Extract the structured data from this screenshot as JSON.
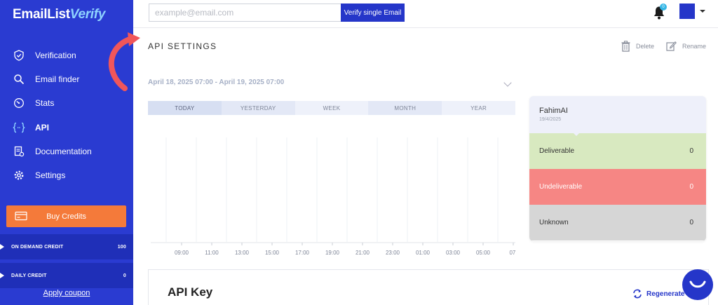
{
  "app": {
    "logo_main": "EmailList",
    "logo_accent": "Verify"
  },
  "sidebar": {
    "items": [
      {
        "label": "Verification",
        "icon": "shield-check-icon"
      },
      {
        "label": "Email finder",
        "icon": "search-icon"
      },
      {
        "label": "Stats",
        "icon": "gauge-icon"
      },
      {
        "label": "API",
        "icon": "braces-icon",
        "active": true
      },
      {
        "label": "Documentation",
        "icon": "document-icon"
      },
      {
        "label": "Settings",
        "icon": "gear-icon"
      }
    ],
    "buy_credits": "Buy Credits",
    "credits": [
      {
        "label": "ON DEMAND CREDIT",
        "value": "100"
      },
      {
        "label": "DAILY CREDIT",
        "value": "0"
      }
    ],
    "coupon": "Apply coupon"
  },
  "topbar": {
    "search_placeholder": "example@email.com",
    "verify_button": "Verify single Email",
    "notification_count": "0"
  },
  "main": {
    "title": "API SETTINGS",
    "actions": {
      "delete": "Delete",
      "rename": "Rename"
    },
    "date_range": "April 18, 2025 07:00 - April 19, 2025 07:00",
    "tabs": [
      "TODAY",
      "YESTERDAY",
      "WEEK",
      "MONTH",
      "YEAR"
    ],
    "active_tab": "TODAY"
  },
  "chart_data": {
    "type": "line",
    "x": [
      "09:00",
      "11:00",
      "13:00",
      "15:00",
      "17:00",
      "19:00",
      "21:00",
      "23:00",
      "01:00",
      "03:00",
      "05:00",
      "07:"
    ],
    "series": [],
    "title": "",
    "xlabel": "",
    "ylabel": "",
    "grid": true
  },
  "summary_card": {
    "name": "FahimAI",
    "date": "19/4/2025",
    "stats": [
      {
        "label": "Deliverable",
        "value": "0"
      },
      {
        "label": "Undeliverable",
        "value": "0"
      },
      {
        "label": "Unknown",
        "value": "0"
      }
    ]
  },
  "api_key": {
    "title": "API Key",
    "regenerate": "Regenerate"
  },
  "colors": {
    "sidebar": "#2a3bd1",
    "primary": "#2536c9",
    "buy_credits": "#f47a3a",
    "deliverable": "#d8e9c0",
    "undeliverable": "#f68684",
    "unknown": "#d6d6d6",
    "arrow": "#f0565a"
  }
}
